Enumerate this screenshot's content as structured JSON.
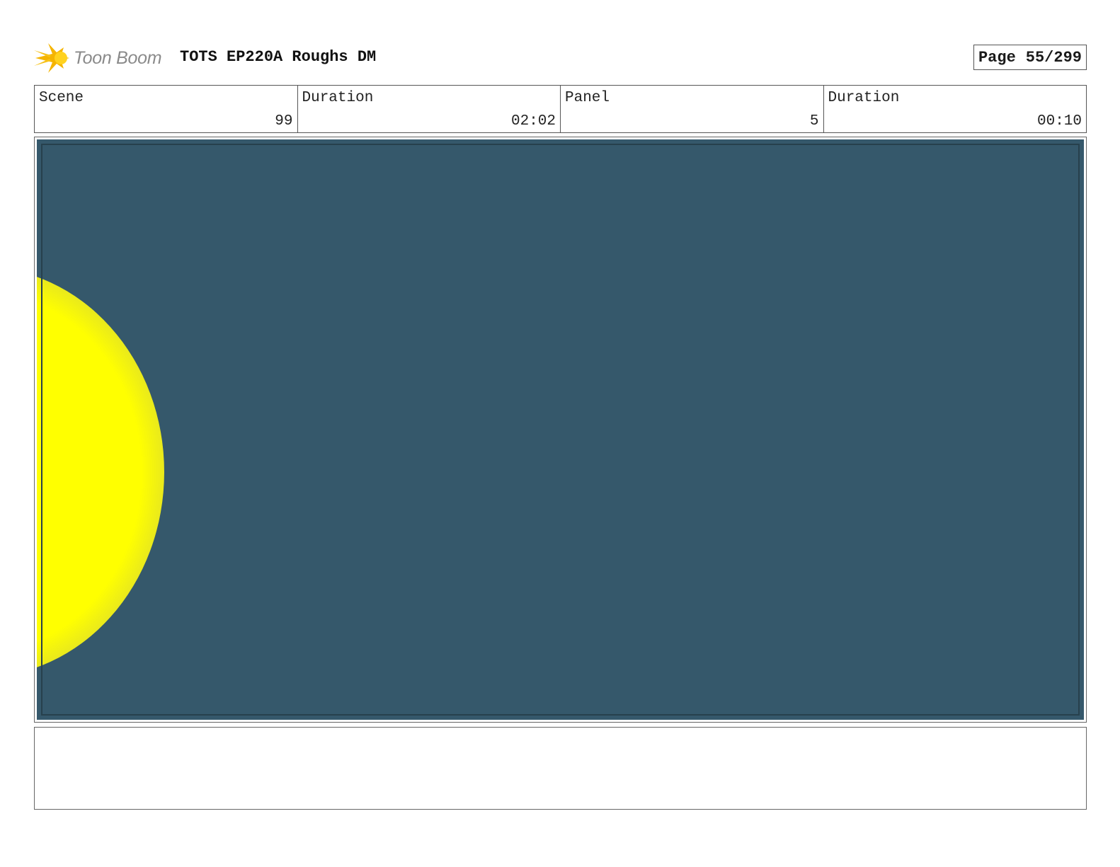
{
  "header": {
    "logo_text": "Toon Boom",
    "title": "TOTS EP220A Roughs DM",
    "page_label": "Page",
    "page_number": "55/299"
  },
  "info": {
    "scene_label": "Scene",
    "scene_value": "99",
    "scene_duration_label": "Duration",
    "scene_duration_value": "02:02",
    "panel_label": "Panel",
    "panel_value": "5",
    "panel_duration_label": "Duration",
    "panel_duration_value": "00:10"
  },
  "panel": {
    "background_color": "#35586b",
    "sun_color": "#ffff00"
  },
  "notes": {
    "text": ""
  }
}
